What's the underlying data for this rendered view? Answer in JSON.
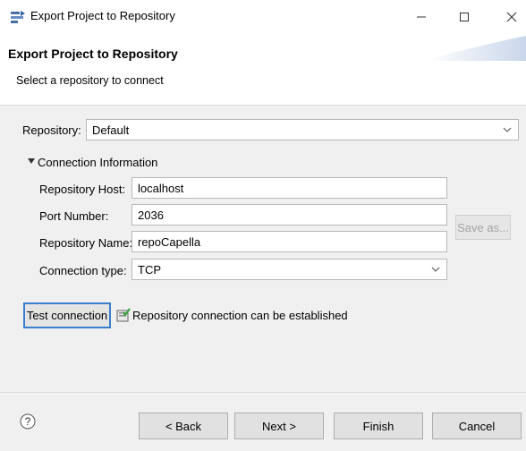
{
  "window": {
    "title": "Export Project to Repository"
  },
  "header": {
    "title": "Export Project to Repository",
    "message": "Select a repository to connect"
  },
  "repository": {
    "label": "Repository:",
    "value": "Default"
  },
  "connection_section": {
    "label": "Connection Information",
    "expanded": true,
    "fields": {
      "host": {
        "label": "Repository Host:",
        "value": "localhost"
      },
      "port": {
        "label": "Port Number:",
        "value": "2036"
      },
      "name": {
        "label": "Repository Name:",
        "value": "repoCapella"
      },
      "type": {
        "label": "Connection type:",
        "value": "TCP"
      }
    },
    "save_as_label": "Save as..."
  },
  "test": {
    "button_label": "Test connection",
    "status_text": "Repository connection can be established"
  },
  "footer": {
    "back_label": "< Back",
    "next_label": "Next >",
    "finish_label": "Finish",
    "cancel_label": "Cancel"
  },
  "icons": {
    "app": "export-wizard-icon",
    "minimize": "minimize-icon",
    "maximize": "maximize-icon",
    "close": "close-icon",
    "expand": "triangle-down-icon",
    "dropdown": "chevron-down-icon",
    "status": "connection-ok-icon",
    "help": "help-icon"
  },
  "colors": {
    "focus_border": "#3a7fc9",
    "status_icon_green": "#3da13d",
    "header_bg": "#ffffff",
    "body_bg": "#f0f0f0"
  }
}
